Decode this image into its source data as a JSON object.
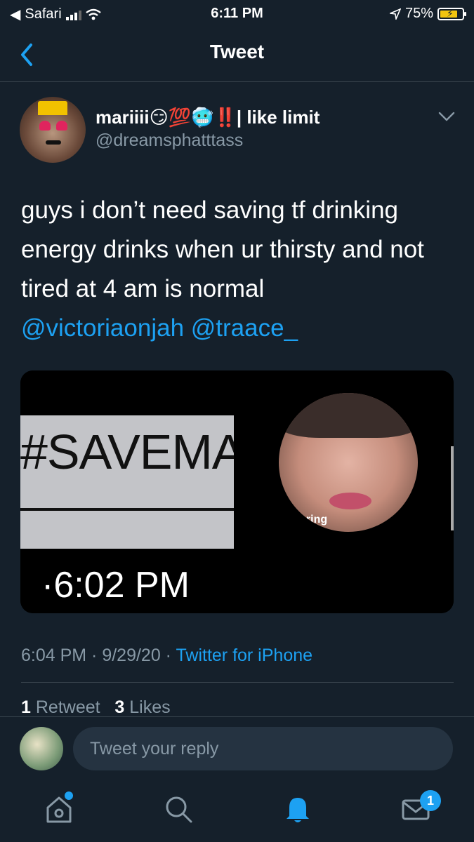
{
  "status_bar": {
    "carrier": "Safari",
    "time": "6:11 PM",
    "battery": "75%"
  },
  "nav": {
    "title": "Tweet"
  },
  "tweet": {
    "display_name": "mariiii😏💯🥶‼️| like limit",
    "handle": "@dreamsphatttass",
    "text": "guys i don’t need saving tf drinking energy drinks when ur thirsty and not tired at 4 am is normal ",
    "mention_1": "@victoriaonjah",
    "mention_2": "@traace_",
    "media": {
      "left_text": "#SAVEMA",
      "left_time": "·6:02 PM",
      "right_label": "ering"
    },
    "timestamp": "6:04 PM · 9/29/20 · ",
    "source": "Twitter for iPhone",
    "retweets_count": "1",
    "retweets_label": "Retweet",
    "likes_count": "3",
    "likes_label": "Likes"
  },
  "reply": {
    "placeholder": "Tweet your reply"
  },
  "tabs": {
    "items": [
      "home-icon",
      "search-icon",
      "notifications-icon",
      "messages-icon"
    ],
    "messages_badge": "1"
  },
  "colors": {
    "background": "#15202b",
    "accent": "#1da1f2",
    "muted": "#8899a6"
  }
}
